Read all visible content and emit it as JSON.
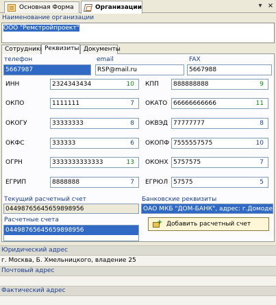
{
  "window": {
    "tabs": [
      {
        "label": "Основная Форма",
        "icon": "form-icon",
        "active": false
      },
      {
        "label": "Организации",
        "icon": "organization-icon",
        "active": true
      }
    ],
    "controls": {
      "dropdown": "▾",
      "close": "×"
    }
  },
  "org": {
    "name_label": "Наименование организации",
    "name_value": "ООО \"Ремстройпроект\""
  },
  "subtabs": [
    {
      "label": "Сотрудники",
      "active": false
    },
    {
      "label": "Реквизиты",
      "active": true
    },
    {
      "label": "Документы",
      "active": false
    }
  ],
  "contacts": {
    "phone_label": "телефон",
    "phone_value": "5667987",
    "email_label": "email",
    "email_value": "RSP@mail.ru",
    "fax_label": "FAX",
    "fax_value": "5667988"
  },
  "requisites": {
    "left": [
      {
        "label": "ИНН",
        "value": "2324343434",
        "digits": "10",
        "digits_color": "green"
      },
      {
        "label": "ОКПО",
        "value": "1111111",
        "digits": "7",
        "digits_color": "blue"
      },
      {
        "label": "ОКОГУ",
        "value": "33333333",
        "digits": "8",
        "digits_color": "blue"
      },
      {
        "label": "ОКФС",
        "value": "333333",
        "digits": "6",
        "digits_color": "blue"
      },
      {
        "label": "ОГРН",
        "value": "3333333333333",
        "digits": "13",
        "digits_color": "green"
      },
      {
        "label": "ЕГРИП",
        "value": "8888888",
        "digits": "7",
        "digits_color": "blue"
      }
    ],
    "right": [
      {
        "label": "КПП",
        "value": "888888888",
        "digits": "9",
        "digits_color": "green"
      },
      {
        "label": "ОКАТО",
        "value": "66666666666",
        "digits": "11",
        "digits_color": "green"
      },
      {
        "label": "ОКВЭД",
        "value": "77777777",
        "digits": "8",
        "digits_color": "blue"
      },
      {
        "label": "ОКОПФ",
        "value": "7555557575",
        "digits": "10",
        "digits_color": "blue"
      },
      {
        "label": "ОКОНХ",
        "value": "5757575",
        "digits": "7",
        "digits_color": "blue"
      },
      {
        "label": "ЕГРЮЛ",
        "value": "57575",
        "digits": "5",
        "digits_color": "blue"
      }
    ]
  },
  "accounts": {
    "current_label": "Текущий расчетный счет",
    "current_value": "04498765645659898956",
    "bank_label": "Банковские реквизиты",
    "bank_value": "ОАО МКБ \"ДОМ-БАНК\", адрес: г.Домодедово",
    "list_label": "Расчетные счета",
    "list_items": [
      "04498765645659898956"
    ],
    "add_button": "Добавить расчетный счет"
  },
  "addresses": {
    "legal_label": "Юридический адрес",
    "legal_value": "г. Москва, Б. Хмельницкого, владение 25",
    "postal_label": "Почтовый адрес",
    "postal_value": "",
    "actual_label": "Фактический адрес",
    "actual_value": ""
  },
  "colors": {
    "label_blue": "#1a3d8f",
    "selection": "#316ac5",
    "digits_green": "#0a8a0a",
    "button_bg": "#fff6d7"
  }
}
